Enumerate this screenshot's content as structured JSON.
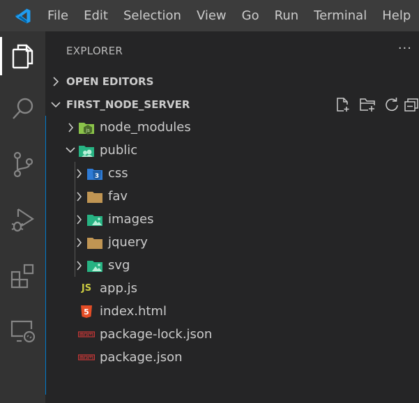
{
  "menu": {
    "items": [
      "File",
      "Edit",
      "Selection",
      "View",
      "Go",
      "Run",
      "Terminal",
      "Help"
    ]
  },
  "activity_bar": {
    "icons": [
      "explorer-icon",
      "search-icon",
      "source-control-icon",
      "run-debug-icon",
      "extensions-icon",
      "remote-explorer-icon"
    ]
  },
  "explorer": {
    "title": "EXPLORER",
    "more": "···",
    "open_editors": "OPEN EDITORS",
    "project": "FIRST_NODE_SERVER"
  },
  "tree": {
    "node_modules": "node_modules",
    "public": "public",
    "css": "css",
    "fav": "fav",
    "images": "images",
    "jquery": "jquery",
    "svg": "svg",
    "app_js": "app.js",
    "index_html": "index.html",
    "package_lock": "package-lock.json",
    "package_json": "package.json"
  },
  "colors": {
    "accent": "#007acc",
    "folder": "#c09553",
    "js": "#cbcb41",
    "html": "#e44d26",
    "json_npm": "#cb3837",
    "css": "#2e7bd6",
    "images": "#27b383",
    "node": "#8bc34a"
  }
}
